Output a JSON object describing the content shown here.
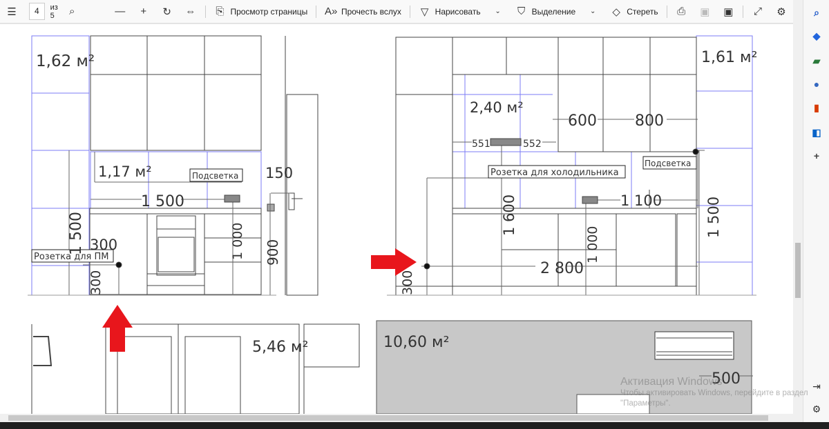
{
  "toolbar": {
    "page_current": "4",
    "page_total": "из 5",
    "page_view": "Просмотр страницы",
    "read_aloud": "Прочесть вслух",
    "draw": "Нарисовать",
    "highlight": "Выделение",
    "erase": "Стереть"
  },
  "drawing": {
    "left": {
      "area_top": "1,62 м²",
      "area_backsplash": "1,17 м²",
      "lighting": "Подсветка",
      "width_dim": "1 500",
      "dim_150": "150",
      "dim_300": "300",
      "socket_label": "Розетка для ПМ",
      "height_dim": "1 500",
      "dim_300_v": "300",
      "dim_1000": "1 000",
      "dim_900": "900"
    },
    "right": {
      "area_right": "1,61 м²",
      "area_backsplash": "2,40 м²",
      "dim_600": "600",
      "dim_800": "800",
      "dim_551": "551",
      "dim_552": "552",
      "socket_label": "Розетка для холодильника",
      "lighting": "Подсветка",
      "dim_1100": "1 100",
      "dim_1600": "1 600",
      "dim_1000": "1 000",
      "dim_2800": "2 800",
      "dim_1500": "1 500",
      "dim_300": "300"
    },
    "bottom": {
      "area_left": "5,46 м²",
      "area_right": "10,60 м²",
      "dim_500": "500"
    }
  },
  "watermark": {
    "title": "Активация Windows",
    "line1": "Чтобы активировать Windows, перейдите в раздел",
    "line2": "\"Параметры\"."
  },
  "colors": {
    "arrow": "#e8161c",
    "blue_grid": "#7b7bf5",
    "floor_gray": "#c8c8c8"
  }
}
